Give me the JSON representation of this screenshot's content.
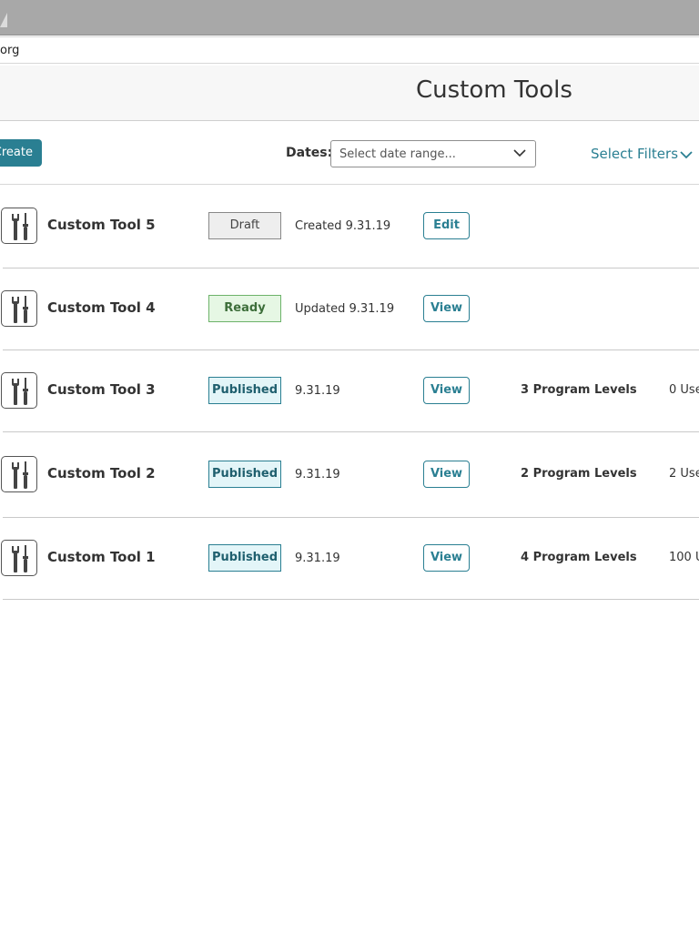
{
  "browser": {
    "url": "org"
  },
  "header": {
    "title": "Custom Tools"
  },
  "toolbar": {
    "create_label": "Create",
    "dates_label": "Dates:",
    "date_placeholder": "Select date range...",
    "filters_label": "Select Filters"
  },
  "colors": {
    "accent": "#2a7f92",
    "ready_green": "#6db36a",
    "draft_gray": "#888888"
  },
  "rows": [
    {
      "name": "Custom Tool 5",
      "status": "Draft",
      "date": "Created 9.31.19",
      "action": "Edit",
      "levels": "",
      "users": ""
    },
    {
      "name": "Custom Tool 4",
      "status": "Ready",
      "date": "Updated 9.31.19",
      "action": "View",
      "levels": "",
      "users": ""
    },
    {
      "name": "Custom Tool 3",
      "status": "Published",
      "date": "9.31.19",
      "action": "View",
      "levels": "3 Program Levels",
      "users": "0 Use"
    },
    {
      "name": "Custom Tool 2",
      "status": "Published",
      "date": "9.31.19",
      "action": "View",
      "levels": "2 Program Levels",
      "users": "2 Use"
    },
    {
      "name": "Custom Tool 1",
      "status": "Published",
      "date": "9.31.19",
      "action": "View",
      "levels": "4 Program Levels",
      "users": "100 U"
    }
  ]
}
